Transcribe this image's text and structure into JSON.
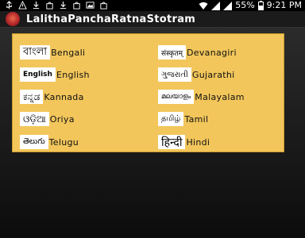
{
  "statusbar": {
    "battery_percent": "55%",
    "time": "9:21 PM"
  },
  "app": {
    "title": "LalithaPanchaRatnaStotram",
    "icon": "app-icon"
  },
  "languages": [
    {
      "script": "বাংলা",
      "label": "Bengali"
    },
    {
      "script": "संस्कृतम्",
      "label": "Devanagiri"
    },
    {
      "script": "English",
      "label": "English"
    },
    {
      "script": "ગુજરાતી",
      "label": "Gujarathi"
    },
    {
      "script": "ಕನ್ನಡ",
      "label": "Kannada"
    },
    {
      "script": "മലയാളം",
      "label": "Malayalam"
    },
    {
      "script": "ଓଡ଼ିଆ",
      "label": "Oriya"
    },
    {
      "script": "தமிழ்",
      "label": "Tamil"
    },
    {
      "script": "తెలుగు",
      "label": "Telugu"
    },
    {
      "script": "हिन्दी",
      "label": "Hindi"
    }
  ],
  "colors": {
    "panel": "#f2c65b",
    "background": "#000000"
  }
}
